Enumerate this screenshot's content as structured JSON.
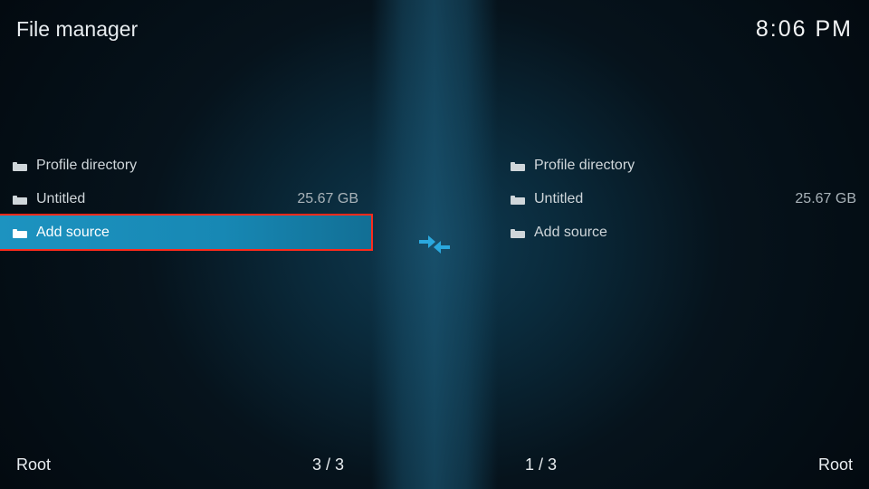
{
  "header": {
    "title": "File manager",
    "clock": "8:06 PM"
  },
  "left": {
    "items": [
      {
        "icon": "folder",
        "label": "Profile directory",
        "size": ""
      },
      {
        "icon": "folder",
        "label": "Untitled",
        "size": "25.67 GB"
      },
      {
        "icon": "folder",
        "label": "Add source",
        "size": "",
        "selected": true,
        "highlight": true
      }
    ],
    "footer_path": "Root",
    "footer_pos": "3 / 3"
  },
  "right": {
    "items": [
      {
        "icon": "folder",
        "label": "Profile directory",
        "size": ""
      },
      {
        "icon": "folder",
        "label": "Untitled",
        "size": "25.67 GB"
      },
      {
        "icon": "folder",
        "label": "Add source",
        "size": ""
      }
    ],
    "footer_path": "Root",
    "footer_pos": "1 / 3"
  }
}
